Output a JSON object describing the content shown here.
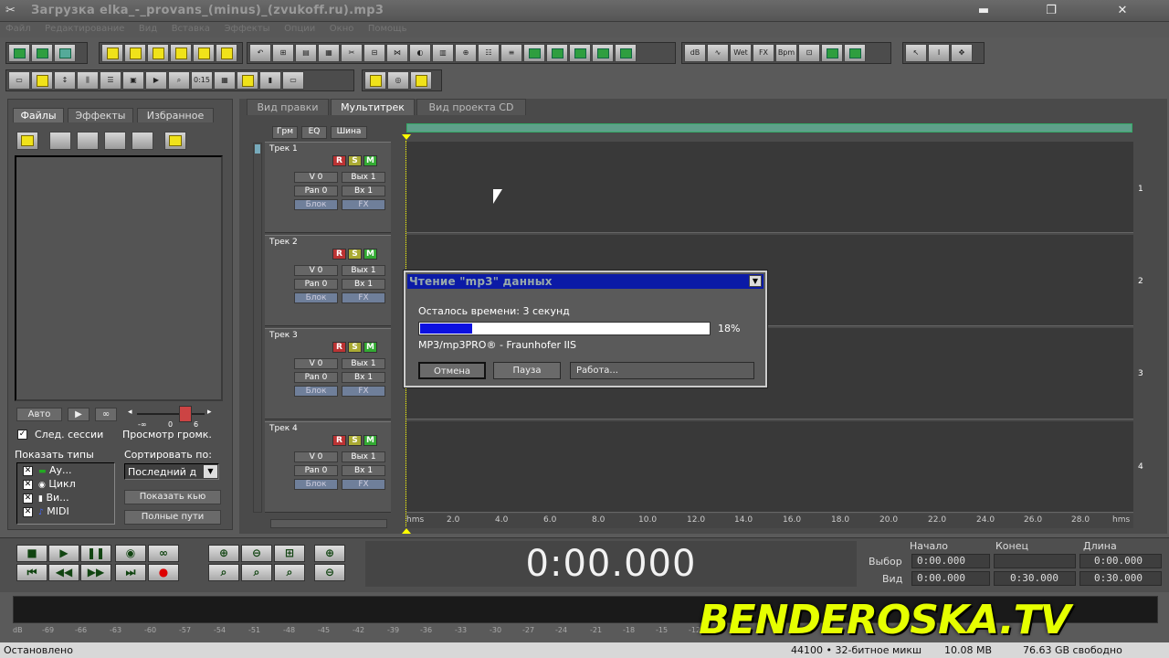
{
  "window": {
    "title": "Загрузка elka_-_provans_(minus)_(zvukoff.ru).mp3",
    "min": "▬",
    "restore": "❐",
    "close": "✕"
  },
  "menu": [
    "Файл",
    "Редактирование",
    "Вид",
    "Вставка",
    "Эффекты",
    "Опции",
    "Окно",
    "Помощь"
  ],
  "left_panel": {
    "tabs": [
      "Файлы",
      "Эффекты",
      "Избранное"
    ],
    "auto_label": "Авто",
    "play_label": "▶",
    "loop_label": "∞",
    "next_session_label": "След. сессии",
    "preview_volume_label": "Просмотр громк.",
    "slider_min": "-∞",
    "slider_mid": "0",
    "slider_max": "6",
    "show_types_label": "Показать типы",
    "types": [
      "Ау...",
      "Цикл",
      "Ви...",
      "MIDI"
    ],
    "sort_label": "Сортировать по:",
    "sort_value": "Последний д",
    "show_btn": "Показать кью",
    "fullpaths_btn": "Полные пути"
  },
  "view_tabs": [
    "Вид правки",
    "Мультитрек",
    "Вид проекта CD"
  ],
  "track_header_tabs": [
    "Грм",
    "EQ",
    "Шина"
  ],
  "tracks": [
    {
      "name": "Трек 1",
      "num": "1",
      "r": "R",
      "s": "S",
      "m": "M",
      "v": "V 0",
      "out": "Вых 1",
      "pan": "Pan 0",
      "in": "Вх 1",
      "lock": "Блок",
      "fx": "FX"
    },
    {
      "name": "Трек 2",
      "num": "2",
      "r": "R",
      "s": "S",
      "m": "M",
      "v": "V 0",
      "out": "Вых 1",
      "pan": "Pan 0",
      "in": "Вх 1",
      "lock": "Блок",
      "fx": "FX"
    },
    {
      "name": "Трек 3",
      "num": "3",
      "r": "R",
      "s": "S",
      "m": "M",
      "v": "V 0",
      "out": "Вых 1",
      "pan": "Pan 0",
      "in": "Вх 1",
      "lock": "Блок",
      "fx": "FX"
    },
    {
      "name": "Трек 4",
      "num": "4",
      "r": "R",
      "s": "S",
      "m": "M",
      "v": "V 0",
      "out": "Вых 1",
      "pan": "Pan 0",
      "in": "Вх 1",
      "lock": "Блок",
      "fx": "FX"
    }
  ],
  "ruler": [
    "hms",
    "2.0",
    "4.0",
    "6.0",
    "8.0",
    "10.0",
    "12.0",
    "14.0",
    "16.0",
    "18.0",
    "20.0",
    "22.0",
    "24.0",
    "26.0",
    "28.0",
    "hms"
  ],
  "dialog": {
    "title": "Чтение \"mp3\" данных",
    "remaining": "Осталось времени: 3 секунд",
    "percent": "18%",
    "progress": 0.18,
    "codec": "MP3/mp3PRO® - Fraunhofer IIS",
    "cancel": "Отмена",
    "pause": "Пауза",
    "status": "Работа..."
  },
  "transport": {
    "time": "0:00.000"
  },
  "selection": {
    "headers": [
      "Начало",
      "Конец",
      "Длина"
    ],
    "row1_label": "Выбор",
    "row1": [
      "0:00.000",
      "",
      "0:00.000"
    ],
    "row2_label": "Вид",
    "row2": [
      "0:00.000",
      "0:30.000",
      "0:30.000"
    ]
  },
  "meter_scale": [
    "dB",
    "-69",
    "-66",
    "-63",
    "-60",
    "-57",
    "-54",
    "-51",
    "-48",
    "-45",
    "-42",
    "-39",
    "-36",
    "-33",
    "-30",
    "-27",
    "-24",
    "-21",
    "-18",
    "-15",
    "-12"
  ],
  "status": {
    "left": "Остановлено",
    "format": "44100 • 32-битное микш",
    "mem": "10.08 MB",
    "disk": "76.63 GB свободно"
  },
  "watermark": "BENDEROSKA.TV"
}
